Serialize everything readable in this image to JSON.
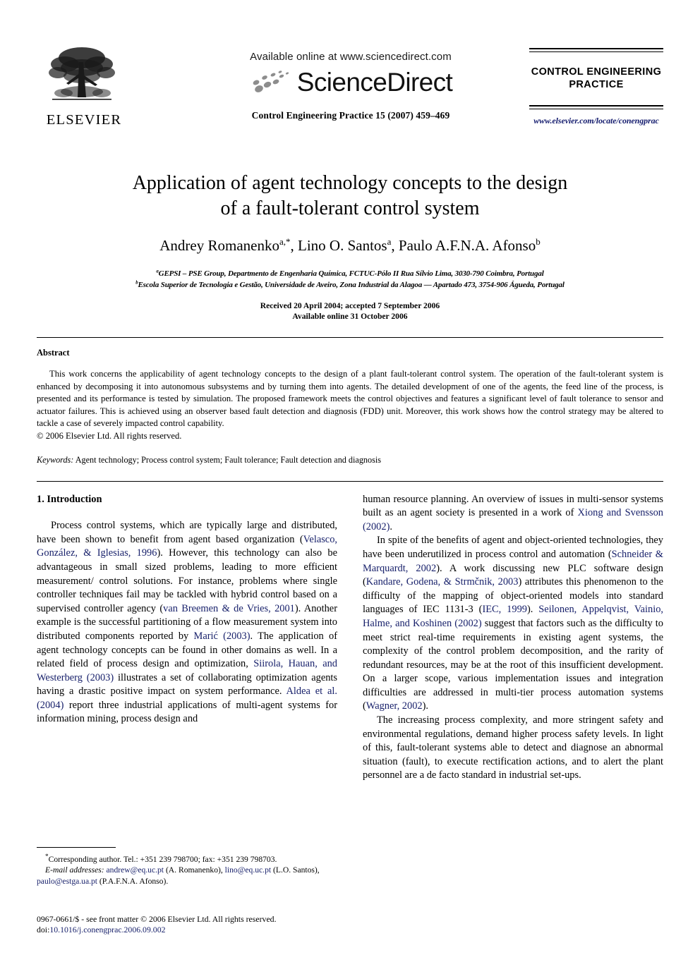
{
  "masthead": {
    "publisher_name": "ELSEVIER",
    "available_online": "Available online at www.sciencedirect.com",
    "sciencedirect_wordmark": "ScienceDirect",
    "journal_reference": "Control Engineering Practice 15 (2007) 459–469",
    "journal_title": "CONTROL ENGINEERING PRACTICE",
    "journal_url": "www.elsevier.com/locate/conengprac"
  },
  "article": {
    "title_line1": "Application of agent technology concepts to the design",
    "title_line2": "of a fault-tolerant control system",
    "authors": [
      {
        "name": "Andrey Romanenko",
        "marks": "a,*"
      },
      {
        "name": "Lino O. Santos",
        "marks": "a"
      },
      {
        "name": "Paulo A.F.N.A. Afonso",
        "marks": "b"
      }
    ],
    "affiliations": [
      {
        "mark": "a",
        "text": "GEPSI – PSE Group, Departmento de Engenharia Química, FCTUC-Pólo II Rua Sílvio Lima, 3030-790 Coimbra, Portugal"
      },
      {
        "mark": "b",
        "text": "Escola Superior de Tecnologia e Gestão, Universidade de Aveiro, Zona Industrial da Alagoa — Apartado 473, 3754-906 Águeda, Portugal"
      }
    ],
    "received_line": "Received 20 April 2004; accepted 7 September 2006",
    "available_line": "Available online 31 October 2006"
  },
  "abstract": {
    "heading": "Abstract",
    "body": "This work concerns the applicability of agent technology concepts to the design of a plant fault-tolerant control system. The operation of the fault-tolerant system is enhanced by decomposing it into autonomous subsystems and by turning them into agents. The detailed development of one of the agents, the feed line of the process, is presented and its performance is tested by simulation. The proposed framework meets the control objectives and features a significant level of fault tolerance to sensor and actuator failures. This is achieved using an observer based fault detection and diagnosis (FDD) unit. Moreover, this work shows how the control strategy may be altered to tackle a case of severely impacted control capability.",
    "copyright": "© 2006 Elsevier Ltd. All rights reserved."
  },
  "keywords": {
    "label": "Keywords:",
    "value": "Agent technology; Process control system; Fault tolerance; Fault detection and diagnosis"
  },
  "sections": {
    "intro_heading": "1.  Introduction"
  },
  "left_column": {
    "para1_a": "Process control systems, which are typically large and distributed, have been shown to benefit from agent based organization (",
    "cite1": "Velasco, González, & Iglesias, 1996",
    "para1_b": "). However, this technology can also be advantageous in small sized problems, leading to more efficient measurement/ control solutions. For instance, problems where single controller techniques fail may be tackled with hybrid control based on a supervised controller agency (",
    "cite2": "van Breemen & de Vries, 2001",
    "para1_c": "). Another example is the successful partitioning of a flow measurement system into distributed components reported by ",
    "cite3": "Marić (2003)",
    "para1_d": ". The application of agent technology concepts can be found in other domains as well. In a related field of process design and optimization, ",
    "cite4": "Siirola, Hauan, and Westerberg (2003)",
    "para1_e": " illustrates a set of collaborating optimization agents having a drastic positive impact on system performance. ",
    "cite5": "Aldea et al. (2004)",
    "para1_f": " report three industrial applications of multi-agent systems for information mining, process design and"
  },
  "right_column": {
    "para1_cont": "human resource planning. An overview of issues in multi-sensor systems built as an agent society is presented in a work of ",
    "cite6": "Xiong and Svensson (2002)",
    "para1_end": ".",
    "para2_a": "In spite of the benefits of agent and object-oriented technologies, they have been underutilized in process control and automation (",
    "cite7": "Schneider & Marquardt, 2002",
    "para2_b": "). A work discussing new PLC software design (",
    "cite8": "Kandare, Godena, & Strmčnik, 2003",
    "para2_c": ") attributes this phenomenon to the difficulty of the mapping of object-oriented models into standard languages of IEC 1131-3 (",
    "cite9": "IEC, 1999",
    "para2_d": "). ",
    "cite10": "Seilonen, Appelqvist, Vainio, Halme, and Koshinen (2002)",
    "para2_e": " suggest that factors such as the difficulty to meet strict real-time requirements in existing agent systems, the complexity of the control problem decomposition, and the rarity of redundant resources, may be at the root of this insufficient development. On a larger scope, various implementation issues and integration difficulties are addressed in multi-tier process automation systems (",
    "cite11": "Wagner, 2002",
    "para2_f": ").",
    "para3": "The increasing process complexity, and more stringent safety and environmental regulations, demand higher process safety levels. In light of this, fault-tolerant systems able to detect and diagnose an abnormal situation (fault), to execute rectification actions, and to alert the plant personnel are a de facto standard in industrial set-ups."
  },
  "footnotes": {
    "corresponding_mark": "*",
    "corresponding": "Corresponding author. Tel.: +351 239 798700; fax: +351 239 798703.",
    "email_label": "E-mail addresses:",
    "email1": "andrew@eq.uc.pt",
    "email1_owner": "(A. Romanenko),",
    "email2": "lino@eq.uc.pt",
    "email2_owner": "(L.O. Santos),",
    "email3": "paulo@estga.ua.pt",
    "email3_owner": "(P.A.F.N.A. Afonso)."
  },
  "issn_footer": {
    "line1": "0967-0661/$ - see front matter © 2006 Elsevier Ltd. All rights reserved.",
    "doi_label": "doi:",
    "doi_value": "10.1016/j.conengprac.2006.09.002"
  },
  "colors": {
    "link": "#18216b",
    "masthead_url": "#141c6e"
  }
}
